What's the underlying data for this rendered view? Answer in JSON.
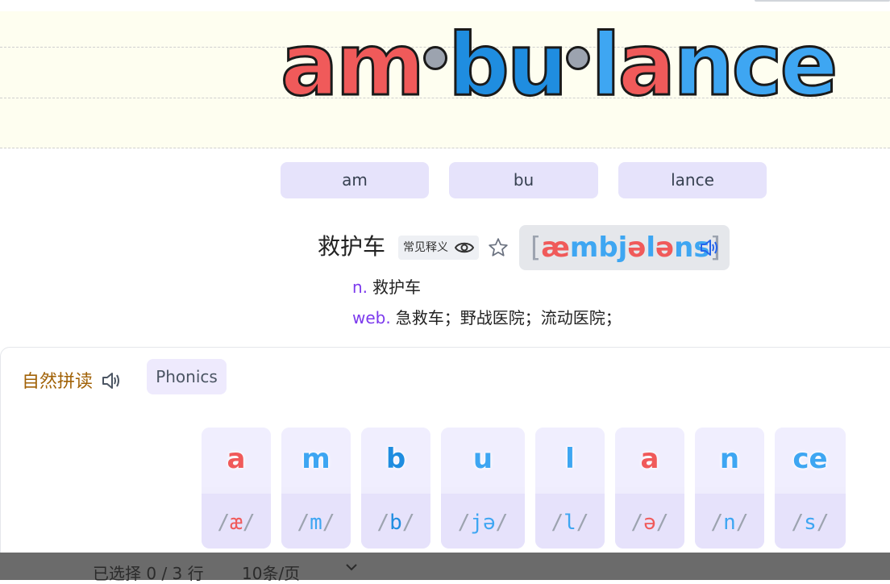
{
  "word": {
    "segments": [
      {
        "text": "am",
        "color": "#f05a5a"
      },
      {
        "text": "bu",
        "color": "#1f8de0"
      },
      {
        "text": "l",
        "color": "#3ea6f2"
      },
      {
        "text": "a",
        "color": "#f05a5a"
      },
      {
        "text": "nce",
        "color": "#3ea6f2"
      }
    ]
  },
  "syllables": [
    "am",
    "bu",
    "lance"
  ],
  "meaning": {
    "title": "救护车",
    "common_badge": "常见释义",
    "phonetic": {
      "open": "[",
      "close": "]",
      "parts": [
        {
          "text": "æ",
          "color": "#f05a5a"
        },
        {
          "text": "mbj",
          "color": "#3ea6f2"
        },
        {
          "text": "ə",
          "color": "#f05a5a"
        },
        {
          "text": "l",
          "color": "#3ea6f2"
        },
        {
          "text": "ə",
          "color": "#f05a5a"
        },
        {
          "text": "ns",
          "color": "#3ea6f2"
        }
      ]
    },
    "definitions": [
      {
        "pos": "n.",
        "text": "救护车"
      },
      {
        "pos": "web.",
        "text": "急救车；野战医院；流动医院；"
      }
    ]
  },
  "phonics": {
    "title": "自然拼读",
    "tag": "Phonics",
    "tiles": [
      {
        "letter": "a",
        "ipa": "æ",
        "color": "#f05a5a"
      },
      {
        "letter": "m",
        "ipa": "m",
        "color": "#3ea6f2"
      },
      {
        "letter": "b",
        "ipa": "b",
        "color": "#1f8de0"
      },
      {
        "letter": "u",
        "ipa": "jə",
        "color": "#3ea6f2"
      },
      {
        "letter": "l",
        "ipa": "l",
        "color": "#3ea6f2"
      },
      {
        "letter": "a",
        "ipa": "ə",
        "color": "#f05a5a"
      },
      {
        "letter": "n",
        "ipa": "n",
        "color": "#3ea6f2"
      },
      {
        "letter": "ce",
        "ipa": "s",
        "color": "#3ea6f2"
      }
    ]
  },
  "footer": {
    "selected": "已选择 0 / 3 行",
    "per_page": "10条/页"
  },
  "colors": {
    "red": "#f05a5a",
    "blue": "#3ea6f2",
    "dark_blue": "#1f8de0",
    "purple": "#7c3aed",
    "gold": "#a16207"
  }
}
